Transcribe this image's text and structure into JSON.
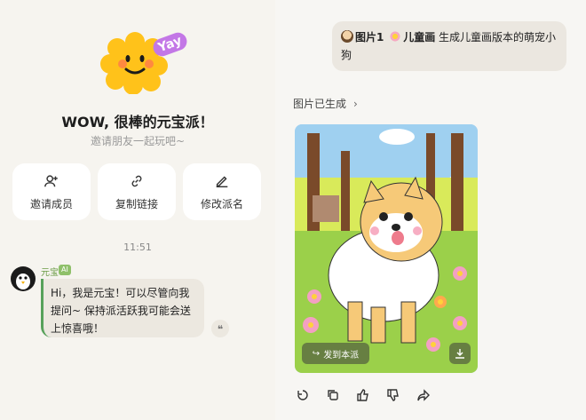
{
  "welcome": {
    "badge": "Yay",
    "title": "WOW, 很棒的元宝派！",
    "subtitle": "邀请朋友一起玩吧~"
  },
  "actions": [
    {
      "label": "邀请成员",
      "icon": "add-user-icon"
    },
    {
      "label": "复制链接",
      "icon": "link-icon"
    },
    {
      "label": "修改派名",
      "icon": "edit-icon"
    }
  ],
  "chat": {
    "time": "11:51",
    "bot_name": "元宝",
    "bot_badge": "AI",
    "bot_message": "Hi，我是元宝！可以尽管向我提问~ 保持派活跃我可能会送上惊喜哦！",
    "user_message": {
      "chip1": "图片1",
      "chip2": "儿童画",
      "text": "生成儿童画版本的萌宠小狗"
    }
  },
  "generation": {
    "status": "图片已生成",
    "send_label": "发到本派"
  },
  "toolbar_icons": [
    "retry-icon",
    "copy-icon",
    "thumbs-up-icon",
    "thumbs-down-icon",
    "share-icon"
  ],
  "colors": {
    "accent_green": "#57a15a",
    "bubble_bg": "#ece8e0",
    "ai_badge": "#8fc06a"
  }
}
